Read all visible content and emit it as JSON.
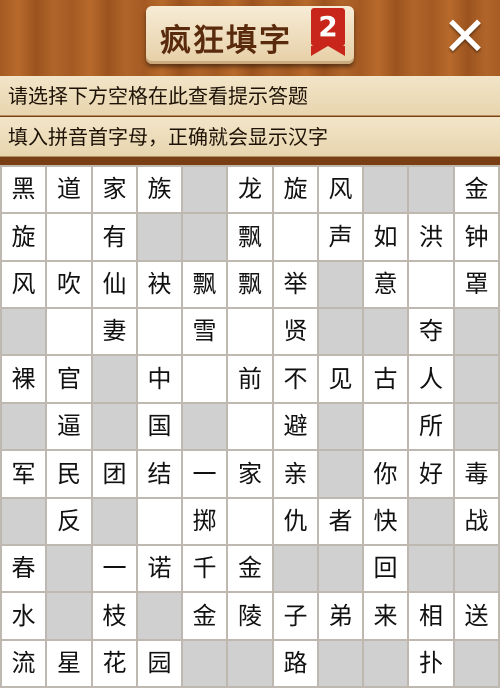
{
  "app": {
    "title": "疯狂填字",
    "title_badge": "2",
    "close_label": "✕"
  },
  "hints": {
    "line1": "请选择下方空格在此查看提示答题",
    "line2": "填入拼音首字母，正确就会显示汉字"
  },
  "colors": {
    "wood": "#a45a22",
    "hint_bg": "#f2e5c8",
    "cell_filled": "#ffffff",
    "cell_blocked": "#d0d0d0",
    "badge": "#c8261a"
  },
  "grid": {
    "rows": [
      [
        "黑",
        "道",
        "家",
        "族",
        "#",
        "龙",
        "旋",
        "风",
        "#",
        "#",
        "金"
      ],
      [
        "旋",
        "",
        "有",
        "#",
        "#",
        "飘",
        "",
        "声",
        "如",
        "洪",
        "钟"
      ],
      [
        "风",
        "吹",
        "仙",
        "袂",
        "飘",
        "飘",
        "举",
        "#",
        "意",
        "",
        "罩"
      ],
      [
        "#",
        "",
        "妻",
        "",
        "雪",
        "",
        "贤",
        "#",
        "#",
        "夺",
        "#"
      ],
      [
        "裸",
        "官",
        "#",
        "中",
        "",
        "前",
        "不",
        "见",
        "古",
        "人",
        "#"
      ],
      [
        "#",
        "逼",
        "#",
        "国",
        "#",
        "",
        "避",
        "#",
        "",
        "所",
        "#"
      ],
      [
        "军",
        "民",
        "团",
        "结",
        "一",
        "家",
        "亲",
        "#",
        "你",
        "好",
        "毒"
      ],
      [
        "#",
        "反",
        "#",
        "",
        "掷",
        "",
        "仇",
        "者",
        "快",
        "#",
        "战"
      ],
      [
        "春",
        "#",
        "一",
        "诺",
        "千",
        "金",
        "#",
        "#",
        "回",
        "#",
        "#"
      ],
      [
        "水",
        "#",
        "枝",
        "#",
        "金",
        "陵",
        "子",
        "弟",
        "来",
        "相",
        "送"
      ],
      [
        "流",
        "星",
        "花",
        "园",
        "#",
        "#",
        "路",
        "#",
        "#",
        "扑",
        "#"
      ]
    ]
  }
}
